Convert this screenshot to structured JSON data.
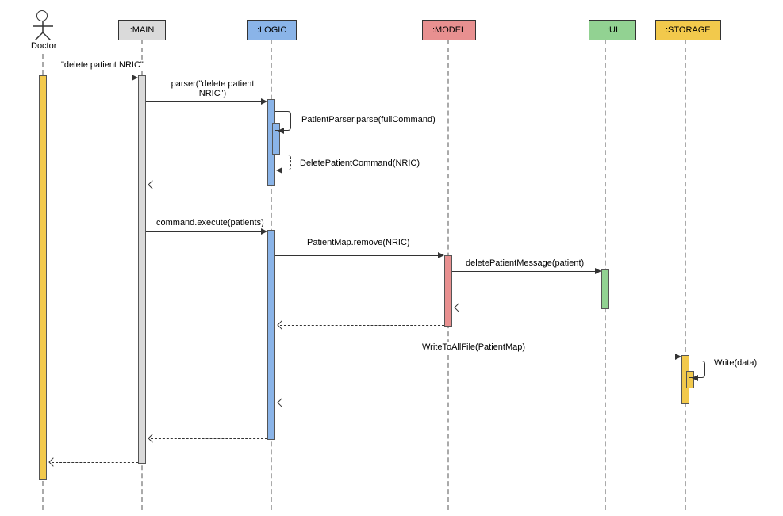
{
  "actor": {
    "label": "Doctor"
  },
  "participants": {
    "main": ":MAIN",
    "logic": ":LOGIC",
    "model": ":MODEL",
    "ui": ":UI",
    "storage": ":STORAGE"
  },
  "messages": {
    "m1": "\"delete patient NRIC\"",
    "m2": "parser(\"delete patient NRIC\")",
    "m3": "PatientParser.parse(fullCommand)",
    "m4": "DeletePatientCommand(NRIC)",
    "m5": "command.execute(patients)",
    "m6": "PatientMap.remove(NRIC)",
    "m7": "deletePatientMessage(patient)",
    "m8": "WriteToAllFile(PatientMap)",
    "m9": "Write(data)"
  },
  "colors": {
    "main": "#dadada",
    "logic": "#8ab4e8",
    "model": "#e89090",
    "ui": "#92d292",
    "storage": "#f2c94c",
    "actor": "#f2c94c"
  },
  "chart_data": {
    "type": "sequence_diagram",
    "actor": "Doctor",
    "participants": [
      ":MAIN",
      ":LOGIC",
      ":MODEL",
      ":UI",
      ":STORAGE"
    ],
    "messages": [
      {
        "from": "Doctor",
        "to": ":MAIN",
        "label": "\"delete patient NRIC\"",
        "type": "sync"
      },
      {
        "from": ":MAIN",
        "to": ":LOGIC",
        "label": "parser(\"delete patient NRIC\")",
        "type": "sync"
      },
      {
        "from": ":LOGIC",
        "to": ":LOGIC",
        "label": "PatientParser.parse(fullCommand)",
        "type": "self"
      },
      {
        "from": ":LOGIC",
        "to": ":LOGIC",
        "label": "DeletePatientCommand(NRIC)",
        "type": "self-return"
      },
      {
        "from": ":LOGIC",
        "to": ":MAIN",
        "label": "",
        "type": "return"
      },
      {
        "from": ":MAIN",
        "to": ":LOGIC",
        "label": "command.execute(patients)",
        "type": "sync"
      },
      {
        "from": ":LOGIC",
        "to": ":MODEL",
        "label": "PatientMap.remove(NRIC)",
        "type": "sync"
      },
      {
        "from": ":MODEL",
        "to": ":UI",
        "label": "deletePatientMessage(patient)",
        "type": "sync"
      },
      {
        "from": ":UI",
        "to": ":MODEL",
        "label": "",
        "type": "return"
      },
      {
        "from": ":MODEL",
        "to": ":LOGIC",
        "label": "",
        "type": "return"
      },
      {
        "from": ":LOGIC",
        "to": ":STORAGE",
        "label": "WriteToAllFile(PatientMap)",
        "type": "sync"
      },
      {
        "from": ":STORAGE",
        "to": ":STORAGE",
        "label": "Write(data)",
        "type": "self"
      },
      {
        "from": ":STORAGE",
        "to": ":LOGIC",
        "label": "",
        "type": "return"
      },
      {
        "from": ":LOGIC",
        "to": ":MAIN",
        "label": "",
        "type": "return"
      },
      {
        "from": ":MAIN",
        "to": "Doctor",
        "label": "",
        "type": "return"
      }
    ]
  }
}
